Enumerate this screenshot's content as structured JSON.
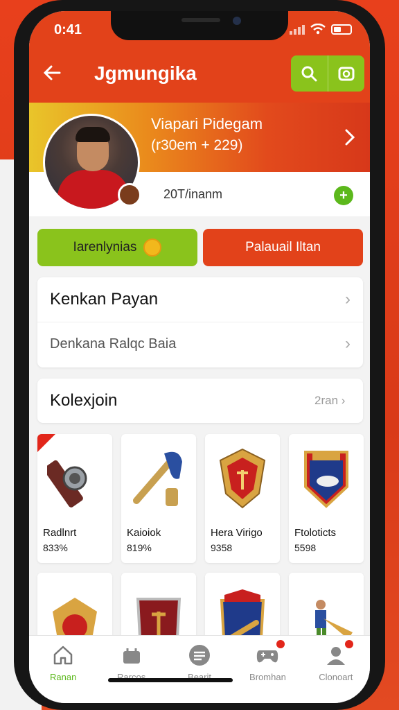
{
  "status": {
    "time": "0:41"
  },
  "header": {
    "title": "Jgmungika"
  },
  "profile": {
    "name": "Viapari Pidegam",
    "subtitle": "(r30em + 229)",
    "followers": "20T/inanm"
  },
  "buttons": {
    "green": "Iarenlynias",
    "red": "Palauail Iltan"
  },
  "menu": {
    "row1": "Kenkan Payan",
    "row2": "Denkana Ralqc Baia"
  },
  "collection": {
    "title": "Kolexjoin",
    "more": "2ran"
  },
  "items": [
    {
      "name": "Radlnrt",
      "price": "833%",
      "icon": "watch-icon"
    },
    {
      "name": "Kaioiok",
      "price": "819%",
      "icon": "trumpet-icon"
    },
    {
      "name": "Hera Virigo",
      "price": "9358",
      "icon": "gold-shield-icon"
    },
    {
      "name": "Ftoloticts",
      "price": "5598",
      "icon": "crest-icon"
    },
    {
      "name": "",
      "price": "",
      "icon": "gold-emblem-icon"
    },
    {
      "name": "",
      "price": "",
      "icon": "red-shield-icon"
    },
    {
      "name": "",
      "price": "",
      "icon": "blue-crest-icon"
    },
    {
      "name": "",
      "price": "",
      "icon": "player-horn-icon"
    }
  ],
  "tabs": [
    {
      "label": "Ranan",
      "icon": "home-icon"
    },
    {
      "label": "Rarcos",
      "icon": "shop-icon"
    },
    {
      "label": "Bearit",
      "icon": "list-icon"
    },
    {
      "label": "Bromhan",
      "icon": "gamepad-icon"
    },
    {
      "label": "Clonoart",
      "icon": "profile-icon"
    }
  ],
  "colors": {
    "accent": "#e2421a",
    "green": "#8ac31c"
  }
}
